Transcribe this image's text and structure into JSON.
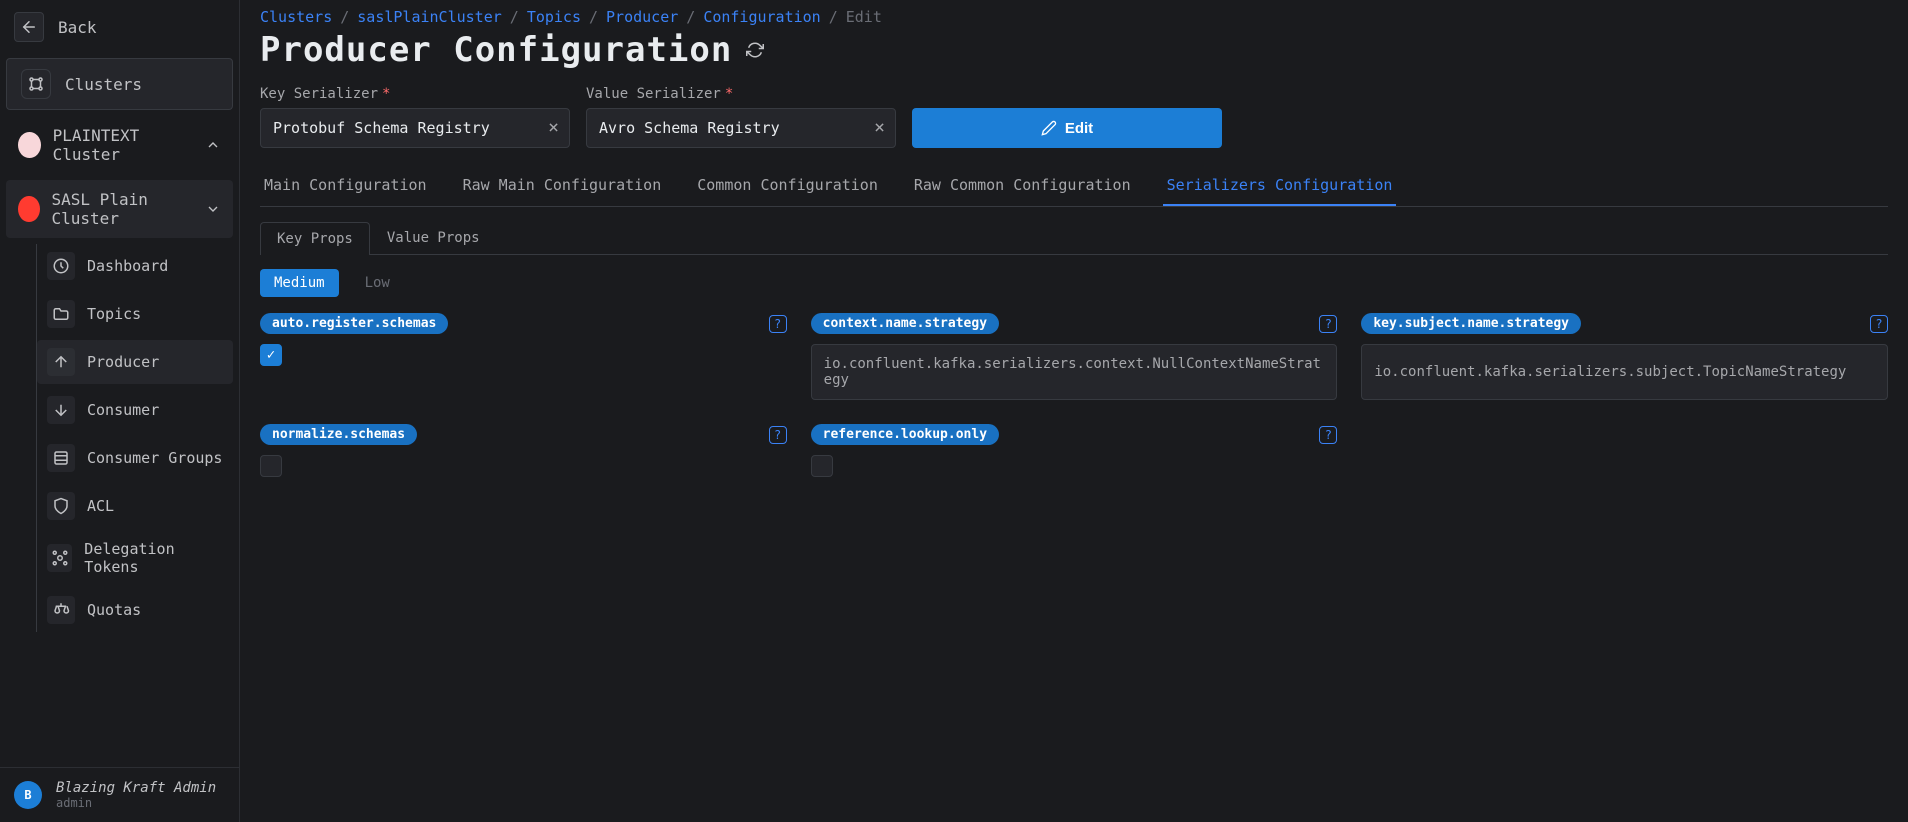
{
  "sidebar": {
    "back_label": "Back",
    "clusters_label": "Clusters",
    "plaintext_cluster": "PLAINTEXT Cluster",
    "sasl_cluster": "SASL Plain Cluster",
    "items": {
      "dashboard": "Dashboard",
      "topics": "Topics",
      "producer": "Producer",
      "consumer": "Consumer",
      "consumer_groups": "Consumer Groups",
      "acl": "ACL",
      "delegation_tokens": "Delegation Tokens",
      "quotas": "Quotas"
    }
  },
  "user": {
    "initial": "B",
    "name": "Blazing Kraft Admin",
    "role": "admin"
  },
  "breadcrumbs": {
    "clusters": "Clusters",
    "cluster_name": "saslPlainCluster",
    "topics": "Topics",
    "producer": "Producer",
    "configuration": "Configuration",
    "edit": "Edit"
  },
  "page_title": "Producer Configuration",
  "fields": {
    "key_serializer_label": "Key Serializer",
    "key_serializer_value": "Protobuf Schema Registry",
    "value_serializer_label": "Value Serializer",
    "value_serializer_value": "Avro Schema Registry"
  },
  "edit_button": "Edit",
  "tabs": {
    "main": "Main Configuration",
    "raw_main": "Raw Main Configuration",
    "common": "Common Configuration",
    "raw_common": "Raw Common Configuration",
    "serializers": "Serializers Configuration"
  },
  "subtabs": {
    "key_props": "Key Props",
    "value_props": "Value Props"
  },
  "filters": {
    "medium": "Medium",
    "low": "Low"
  },
  "props": {
    "auto_register_schemas": {
      "name": "auto.register.schemas",
      "checked": true
    },
    "context_name_strategy": {
      "name": "context.name.strategy",
      "value": "io.confluent.kafka.serializers.context.NullContextNameStrategy"
    },
    "key_subject_name_strategy": {
      "name": "key.subject.name.strategy",
      "value": "io.confluent.kafka.serializers.subject.TopicNameStrategy"
    },
    "normalize_schemas": {
      "name": "normalize.schemas",
      "checked": false
    },
    "reference_lookup_only": {
      "name": "reference.lookup.only",
      "checked": false
    }
  }
}
